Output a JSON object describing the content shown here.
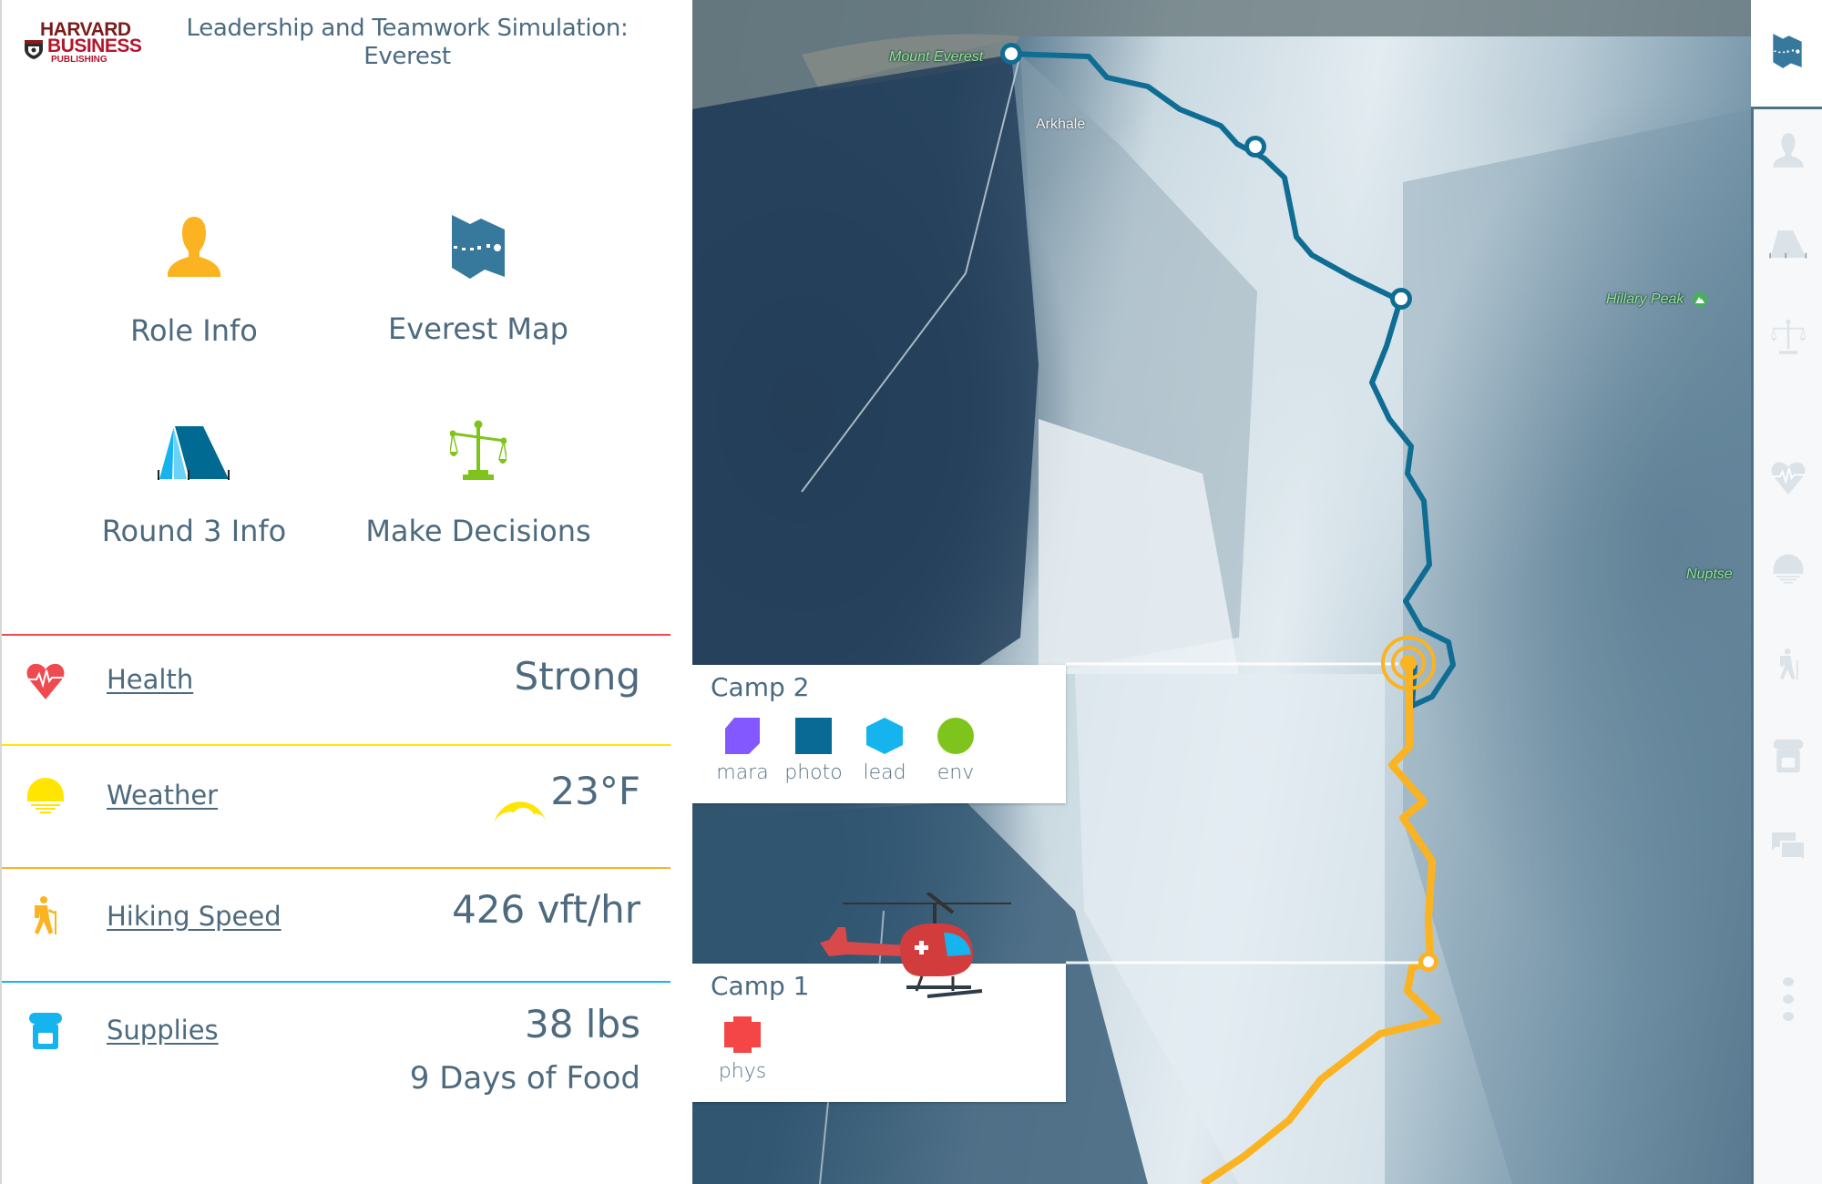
{
  "header": {
    "logo": {
      "line1": "HARVARD",
      "line2": "BUSINESS",
      "line3": "PUBLISHING"
    },
    "title": "Leadership and Teamwork Simulation: Everest"
  },
  "tiles": [
    {
      "label": "Role Info",
      "icon": "person-icon",
      "color": "#fbb321"
    },
    {
      "label": "Everest Map",
      "icon": "map-icon",
      "color": "#36799c"
    },
    {
      "label": "Round 3 Info",
      "icon": "tent-icon",
      "color": "#006a93"
    },
    {
      "label": "Make Decisions",
      "icon": "scales-icon",
      "color": "#7fc41c"
    }
  ],
  "stats": [
    {
      "label": "Health",
      "value": "Strong",
      "icon": "heart-pulse-icon",
      "color": "#ef4a4f"
    },
    {
      "label": "Weather",
      "value": "23°F",
      "icon": "sunset-icon",
      "value_icon": "sun-cloud-icon",
      "color": "#ffe500"
    },
    {
      "label": "Hiking Speed",
      "value": "426 vft/hr",
      "icon": "hiker-icon",
      "color": "#fbb321"
    },
    {
      "label": "Supplies",
      "value": "38 lbs",
      "sub_value": "9 Days of Food",
      "icon": "backpack-icon",
      "color": "#15b4ef"
    }
  ],
  "map": {
    "labels": {
      "mount_everest": "Mount Everest",
      "arkhale": "Arkhale",
      "hillary_peak": "Hillary Peak",
      "nuptse": "Nuptse"
    },
    "route_colors": {
      "completed": "#fbb321",
      "upcoming": "#0f6d94"
    },
    "camps": [
      {
        "name": "Camp 2",
        "current": true,
        "roles": [
          {
            "label": "mara",
            "shape": "cut-square",
            "color": "#8458ff"
          },
          {
            "label": "photo",
            "shape": "square",
            "color": "#0a6a96"
          },
          {
            "label": "lead",
            "shape": "hexagon",
            "color": "#15b4ef"
          },
          {
            "label": "env",
            "shape": "circle",
            "color": "#7fc41c"
          }
        ]
      },
      {
        "name": "Camp 1",
        "current": false,
        "roles": [
          {
            "label": "phys",
            "shape": "cross",
            "color": "#f44646"
          }
        ]
      }
    ],
    "rescue_helicopter": "helicopter-icon"
  },
  "sidebar": {
    "items": [
      {
        "name": "map",
        "icon": "map-icon",
        "active": true
      },
      {
        "name": "role",
        "icon": "person-icon",
        "active": false
      },
      {
        "name": "round",
        "icon": "tent-icon",
        "active": false
      },
      {
        "name": "decisions",
        "icon": "scales-icon",
        "active": false
      },
      {
        "name": "health",
        "icon": "heart-pulse-icon",
        "active": false
      },
      {
        "name": "weather",
        "icon": "sunset-icon",
        "active": false
      },
      {
        "name": "speed",
        "icon": "hiker-icon",
        "active": false
      },
      {
        "name": "supplies",
        "icon": "backpack-icon",
        "active": false
      },
      {
        "name": "chat",
        "icon": "chat-icon",
        "active": false
      },
      {
        "name": "more",
        "icon": "more-vertical-icon",
        "active": false
      }
    ]
  }
}
